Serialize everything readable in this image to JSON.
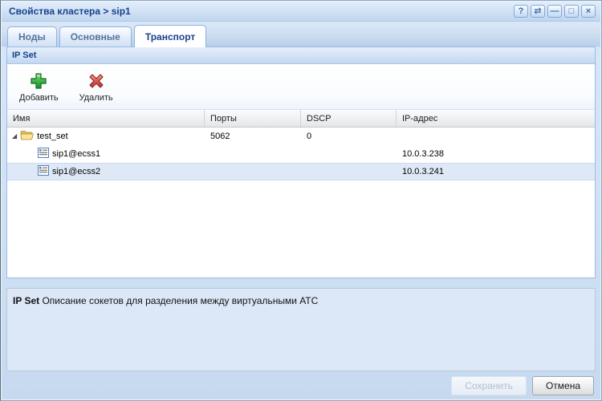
{
  "window": {
    "title": "Свойства кластера > sip1",
    "controls": {
      "help": "?",
      "refresh": "⇄",
      "minimize": "—",
      "maximize": "□",
      "close": "×"
    }
  },
  "tabs": [
    {
      "label": "Ноды",
      "active": false
    },
    {
      "label": "Основные",
      "active": false
    },
    {
      "label": "Транспорт",
      "active": true
    }
  ],
  "ipset_panel": {
    "title": "IP Set"
  },
  "toolbar": {
    "add_label": "Добавить",
    "delete_label": "Удалить"
  },
  "grid": {
    "columns": [
      "Имя",
      "Порты",
      "DSCP",
      "IP-адрес"
    ],
    "rows": [
      {
        "name": "test_set",
        "type": "group",
        "ports": "5062",
        "dscp": "0",
        "ip": "",
        "selected": false
      },
      {
        "name": "sip1@ecss1",
        "type": "leaf",
        "ports": "",
        "dscp": "",
        "ip": "10.0.3.238",
        "selected": false
      },
      {
        "name": "sip1@ecss2",
        "type": "leaf",
        "ports": "",
        "dscp": "",
        "ip": "10.0.3.241",
        "selected": true
      }
    ]
  },
  "description": {
    "title": "IP Set",
    "text": " Описание сокетов для разделения между виртуальными АТС"
  },
  "footer": {
    "save_label": "Сохранить",
    "cancel_label": "Отмена"
  },
  "icons": {
    "expander_expanded": "◢"
  },
  "colors": {
    "accent": "#15428b",
    "selected_row": "#dfe8f6",
    "panel_border": "#99bbe8",
    "add_green": "#3bb54a",
    "delete_red": "#d64541"
  }
}
